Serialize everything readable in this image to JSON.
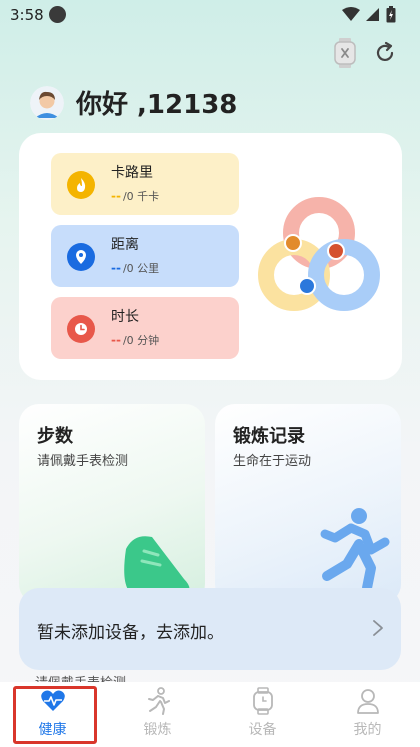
{
  "status_bar": {
    "time": "3:58"
  },
  "greeting": {
    "text": "你好 ,12138"
  },
  "metrics": [
    {
      "label": "卡路里",
      "dash": "--",
      "value": "/0 千卡",
      "icon": "flame-icon",
      "bg": "#fdf0c8",
      "accent": "#f4b400"
    },
    {
      "label": "距离",
      "dash": "--",
      "value": "/0 公里",
      "icon": "location-pin-icon",
      "bg": "#c7ddfb",
      "accent": "#1a6be0"
    },
    {
      "label": "时长",
      "dash": "--",
      "value": "/0 分钟",
      "icon": "clock-icon",
      "bg": "#fcd1cc",
      "accent": "#e8584a"
    }
  ],
  "tiles": {
    "steps": {
      "title": "步数",
      "subtitle": "请佩戴手表检测"
    },
    "workout": {
      "title": "锻炼记录",
      "subtitle": "生命在于运动"
    }
  },
  "device_banner": {
    "text": "暂未添加设备，去添加。"
  },
  "obscured_text": "请佩戴手表检测",
  "nav": [
    {
      "label": "健康",
      "icon": "heart-pulse-icon",
      "active": true
    },
    {
      "label": "锻炼",
      "icon": "running-icon",
      "active": false
    },
    {
      "label": "设备",
      "icon": "watch-icon",
      "active": false
    },
    {
      "label": "我的",
      "icon": "person-icon",
      "active": false
    }
  ],
  "colors": {
    "accent": "#1f77e8",
    "highlight": "#d9362b"
  }
}
